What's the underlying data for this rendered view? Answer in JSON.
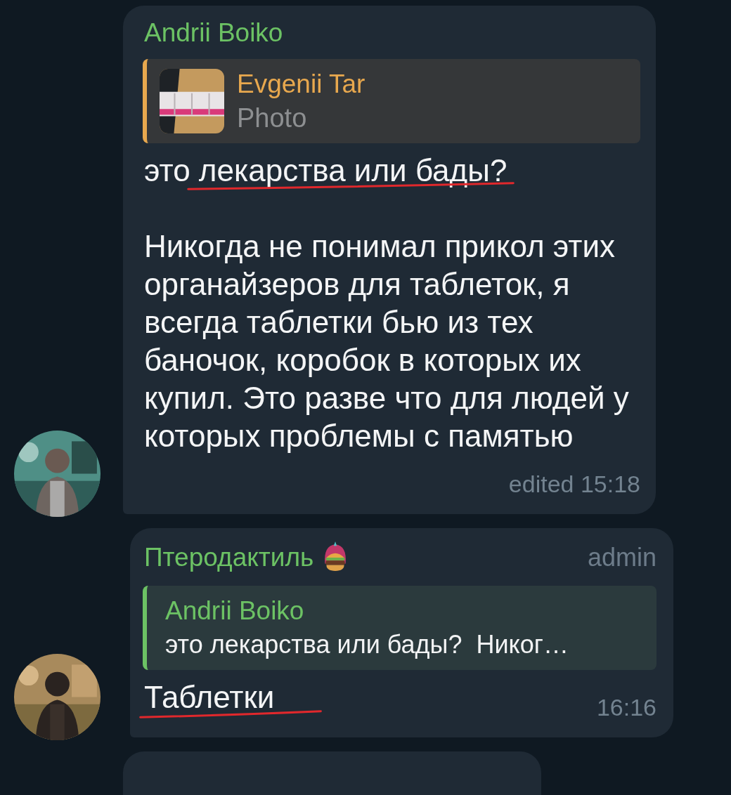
{
  "messages": [
    {
      "sender": "Andrii Boiko",
      "status_emoji": false,
      "avatar": {
        "kind": "picture"
      },
      "reply": {
        "author": "Evgenii Tar",
        "text": "Photo"
      },
      "paragraphs": [
        {
          "text": "это лекарства или бады?",
          "underlined": true
        },
        {
          "text": "Никогда не понимал прикол этих органайзеров для таблеток, я всегда таблетки бью из тех баночок, коробок в которых их купил. Это разве что для людей у которых проблемы с памятью",
          "underlined": false
        }
      ],
      "time": "edited 15:18"
    },
    {
      "sender": "Птеродактиль",
      "status_emoji": true,
      "role": "admin",
      "avatar": {
        "kind": "picture"
      },
      "reply": {
        "author": "Andrii Boiko",
        "text": "это лекарства или бады?  Никог…",
        "kind": "text"
      },
      "paragraphs": [
        {
          "text": "Таблетки",
          "underlined": true
        }
      ],
      "time": "16:16"
    }
  ]
}
